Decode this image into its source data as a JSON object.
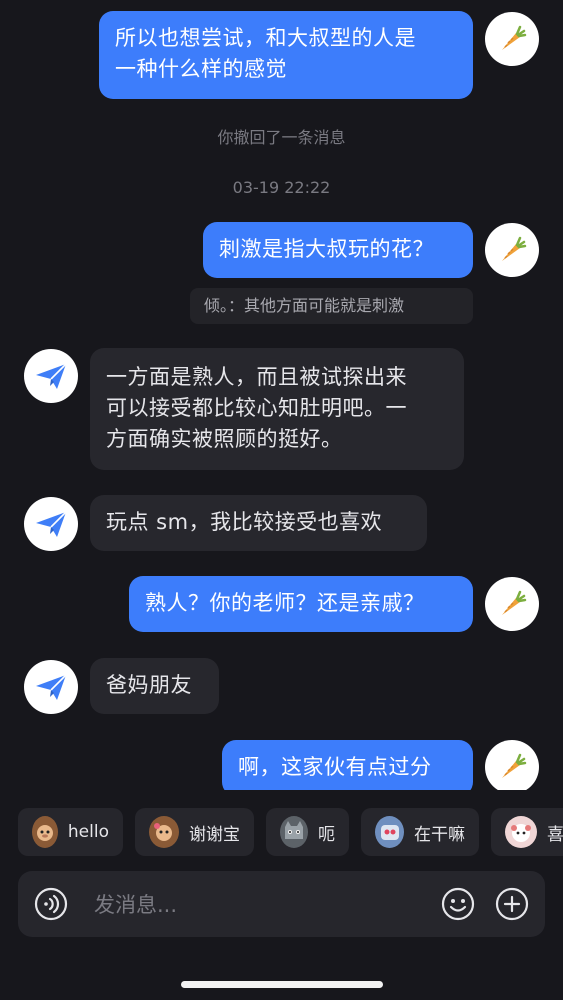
{
  "chat": {
    "messages": [
      {
        "side": "me",
        "lines": [
          "所以也想尝试，和大叔型的人是",
          "一种什么样的感觉"
        ]
      },
      {
        "system": "你撤回了一条消息"
      },
      {
        "time": "03-19 22:22"
      },
      {
        "side": "me",
        "lines": [
          "刺激是指大叔玩的花？"
        ],
        "quote": "倾。：其他方面可能就是刺激"
      },
      {
        "side": "them",
        "lines": [
          "一方面是熟人，而且被试探出来",
          "可以接受都比较心知肚明吧。一",
          "方面确实被照顾的挺好。"
        ]
      },
      {
        "side": "them",
        "lines": [
          "玩点 sm，我比较接受也喜欢"
        ]
      },
      {
        "side": "me",
        "lines": [
          "熟人？你的老师？还是亲戚？"
        ]
      },
      {
        "side": "them",
        "lines": [
          "爸妈朋友"
        ]
      },
      {
        "side": "me",
        "lines": [
          "啊，这家伙有点过分"
        ]
      }
    ],
    "m1": {
      "line1": "所以也想尝试，和大叔型的人是",
      "line2": "一种什么样的感觉"
    },
    "system_recall": "你撤回了一条消息",
    "timestamp": "03-19 22:22",
    "m2": {
      "text": "刺激是指大叔玩的花？",
      "quote": "倾。：其他方面可能就是刺激"
    },
    "m3": {
      "line1": "一方面是熟人，而且被试探出来",
      "line2": "可以接受都比较心知肚明吧。一",
      "line3": "方面确实被照顾的挺好。"
    },
    "m4": {
      "text": "玩点 sm，我比较接受也喜欢"
    },
    "m5": {
      "text": "熟人？你的老师？还是亲戚？"
    },
    "m6": {
      "text": "爸妈朋友"
    },
    "m7": {
      "text": "啊，这家伙有点过分"
    }
  },
  "quick_replies": [
    {
      "label": "hello",
      "icon": "monkey-emoji-icon"
    },
    {
      "label": "谢谢宝",
      "icon": "monkey-flower-emoji-icon"
    },
    {
      "label": "呃",
      "icon": "cat-emoji-icon"
    },
    {
      "label": "在干嘛",
      "icon": "robot-emoji-icon"
    },
    {
      "label": "喜",
      "icon": "sheep-emoji-icon"
    }
  ],
  "composer": {
    "placeholder": "发消息..."
  },
  "icons": {
    "me_avatar": "carrot-icon",
    "them_avatar": "paper-plane-icon",
    "voice": "voice-icon",
    "emoji": "smiley-icon",
    "add": "plus-icon"
  },
  "colors": {
    "background": "#17171c",
    "my_bubble": "#3d7dfb",
    "their_bubble": "#27272d",
    "accent_icon": "#3f7ef7"
  }
}
